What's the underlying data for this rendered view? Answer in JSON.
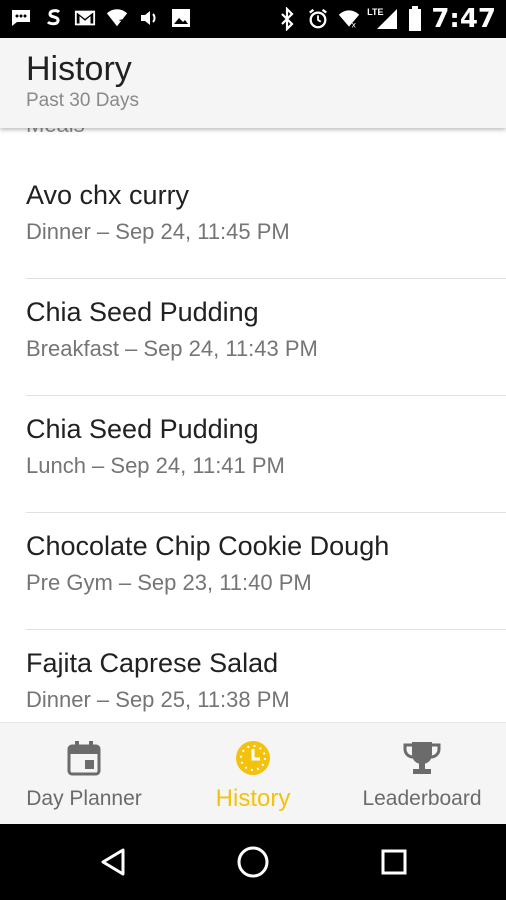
{
  "status_bar": {
    "time": "7:47",
    "network_label": "LTE",
    "left_icons": [
      "messages-icon",
      "s-app-icon",
      "gmail-icon",
      "wifi-question-icon",
      "volume-icon",
      "image-icon"
    ],
    "right_icons": [
      "bluetooth-icon",
      "alarm-icon",
      "wifi-icon",
      "lte-signal-icon",
      "battery-icon"
    ]
  },
  "header": {
    "title": "History",
    "subtitle": "Past 30 Days"
  },
  "list": {
    "section_label": "Meals",
    "items": [
      {
        "title": "Avo chx curry",
        "subtitle": "Dinner – Sep 24, 11:45 PM"
      },
      {
        "title": "Chia Seed Pudding",
        "subtitle": "Breakfast – Sep 24, 11:43 PM"
      },
      {
        "title": "Chia Seed Pudding",
        "subtitle": "Lunch – Sep 24, 11:41 PM"
      },
      {
        "title": "Chocolate Chip Cookie Dough",
        "subtitle": "Pre Gym – Sep 23, 11:40 PM"
      },
      {
        "title": "Fajita Caprese Salad",
        "subtitle": "Dinner – Sep 25, 11:38 PM"
      }
    ]
  },
  "bottom_nav": {
    "items": [
      {
        "label": "Day Planner",
        "icon": "calendar-icon",
        "active": false
      },
      {
        "label": "History",
        "icon": "clock-icon",
        "active": true
      },
      {
        "label": "Leaderboard",
        "icon": "trophy-icon",
        "active": false
      }
    ],
    "active_color": "#f4c20d",
    "inactive_color": "#6b6b6b"
  },
  "system_nav": {
    "buttons": [
      "back-icon",
      "home-icon",
      "recents-icon"
    ]
  }
}
